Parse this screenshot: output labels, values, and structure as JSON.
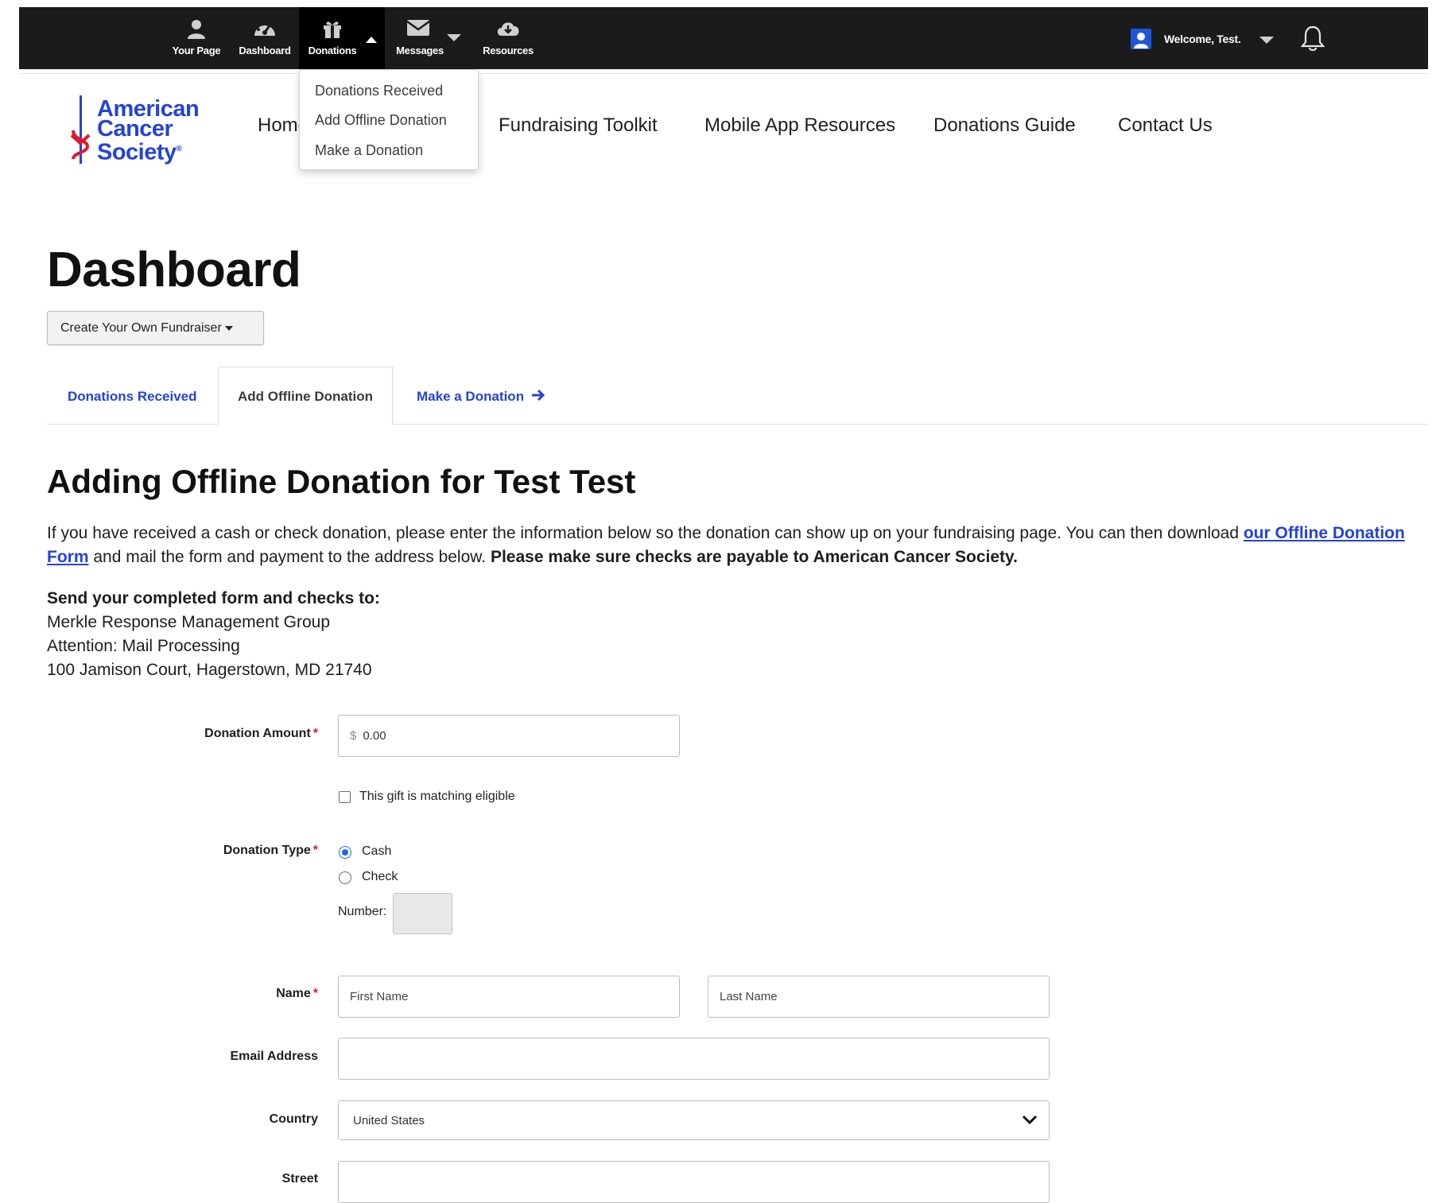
{
  "topbar": {
    "items": [
      {
        "label": "Your Page",
        "icon": "user-icon"
      },
      {
        "label": "Dashboard",
        "icon": "dashboard-icon"
      },
      {
        "label": "Donations",
        "icon": "gift-icon"
      },
      {
        "label": "Messages",
        "icon": "envelope-icon"
      },
      {
        "label": "Resources",
        "icon": "cloud-download-icon"
      }
    ],
    "welcome": "Welcome, Test."
  },
  "donations_menu": [
    "Donations Received",
    "Add Offline Donation",
    "Make a Donation"
  ],
  "brand": {
    "line1": "American",
    "line2": "Cancer",
    "line3": "Society",
    "mark": "®",
    "color": "#2443d6",
    "sword_color": "#e0182d"
  },
  "nav": [
    "Home",
    "Fundraising Toolkit",
    "Mobile App Resources",
    "Donations Guide",
    "Contact Us"
  ],
  "page_title": "Dashboard",
  "create_button": "Create Your Own Fundraiser",
  "tabs": [
    {
      "label": "Donations Received"
    },
    {
      "label": "Add Offline Donation"
    },
    {
      "label": "Make a Donation"
    }
  ],
  "section_title": "Adding Offline Donation for Test Test",
  "intro": {
    "text1": "If you have received a cash or check donation, please enter the information below so the donation can show up on your fundraising page.  You can then download ",
    "link": "our Offline Donation Form",
    "text2": " and mail the form and payment to the address below. ",
    "bold": "Please make sure checks are payable to American Cancer Society."
  },
  "address": {
    "heading": "Send your completed form and checks to:",
    "line1": "Merkle Response Management Group",
    "line2": "Attention: Mail Processing",
    "line3": "100 Jamison Court, Hagerstown, MD 21740"
  },
  "form": {
    "amount_label": "Donation Amount",
    "currency": "$",
    "amount_value": "0.00",
    "matching_label": "This gift is matching eligible",
    "type_label": "Donation Type",
    "type_options": [
      "Cash",
      "Check"
    ],
    "type_selected": "Cash",
    "number_label": "Number:",
    "name_label": "Name",
    "first_placeholder": "First Name",
    "last_placeholder": "Last Name",
    "email_label": "Email Address",
    "country_label": "Country",
    "country_value": "United States",
    "street_label": "Street"
  },
  "colors": {
    "accent": "#2443d6",
    "required": "#e0182d",
    "topbar": "#1b1b1b",
    "radio": "#1a66e8"
  }
}
